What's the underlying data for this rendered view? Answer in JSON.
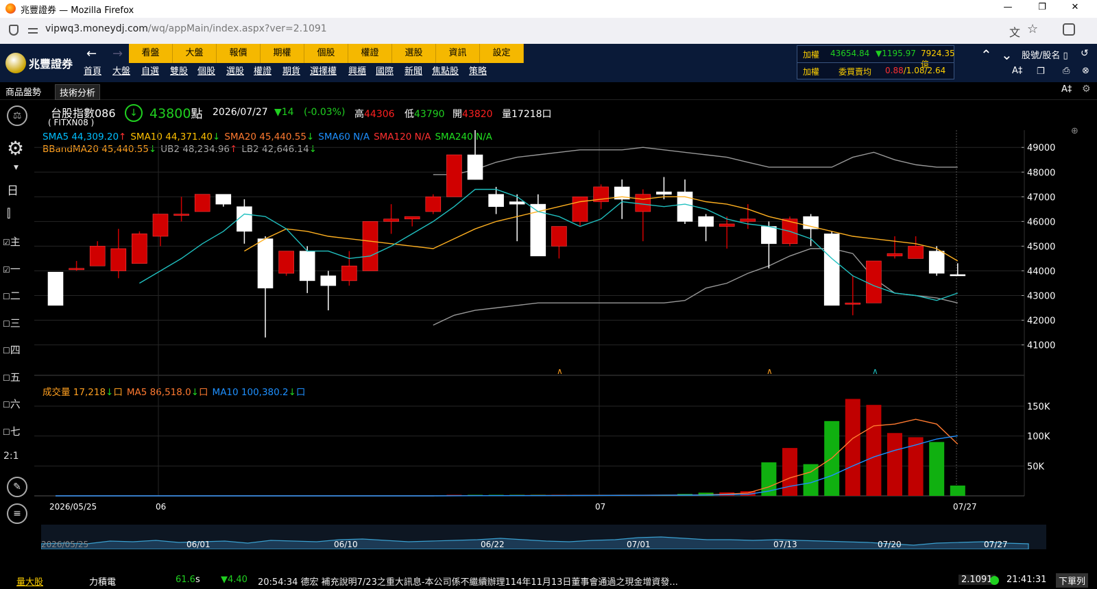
{
  "window": {
    "title": "兆豐證券 — Mozilla Firefox",
    "minimize": "—",
    "maximize": "❐",
    "close": "✕"
  },
  "urlbar": {
    "url_host": "vipwq3.moneydj.com",
    "url_path": "/wq/appMain/index.aspx?ver=2.1091"
  },
  "app": {
    "logo_text": "兆豐證券"
  },
  "menu_top": [
    "看盤",
    "大盤",
    "報價",
    "期權",
    "個股",
    "權證",
    "選股",
    "資訊",
    "設定"
  ],
  "menu_bottom": [
    "首頁",
    "大盤",
    "自選",
    "雙股",
    "個股",
    "選股",
    "權證",
    "期貨",
    "選擇權",
    "興櫃",
    "國際",
    "新聞",
    "焦點股",
    "策略"
  ],
  "index_panel": {
    "row1_label": "加權",
    "row1_value": "43654.84",
    "row1_change": "▼1195.97",
    "row1_amount": "7924.35億",
    "row2_label": "加權",
    "row2_sub": "委買賣均",
    "row2_v1": "0.88",
    "row2_sep1": "/",
    "row2_v2": "1.08",
    "row2_sep2": "/",
    "row2_v3": "2.64"
  },
  "right_tools": {
    "search_label": "股號/股名",
    "font_label": "A‡",
    "font2_label": "A‡"
  },
  "subtabs": [
    "商品盤勢",
    "技術分析"
  ],
  "left_items": [
    "主",
    "一",
    "二",
    "三",
    "四",
    "五",
    "六",
    "七"
  ],
  "left_ratio": "2:1",
  "header": {
    "name": "台股指數086",
    "code": "( FITXN08 )",
    "price": "43800",
    "price_unit": "點",
    "date": "2026/07/27",
    "change": "▼14",
    "change_pct": "(-0.03%)",
    "high_label": "高",
    "high": "44306",
    "low_label": "低",
    "low": "43790",
    "open_label": "開",
    "open": "43820",
    "vol_label": "量",
    "vol": "17218口"
  },
  "indicators_row1": [
    {
      "text": "SMA5 44,309.20",
      "arrow": "↑",
      "color": "#00bfff",
      "arrow_color": "#ff3030"
    },
    {
      "text": "SMA10 44,371.40",
      "arrow": "↓",
      "color": "#ffc000",
      "arrow_color": "#20d020"
    },
    {
      "text": "SMA20 45,440.55",
      "arrow": "↓",
      "color": "#ff7a30",
      "arrow_color": "#20d020"
    },
    {
      "text": "SMA60 N/A",
      "arrow": "",
      "color": "#1e90ff",
      "arrow_color": "#fff"
    },
    {
      "text": "SMA120 N/A",
      "arrow": "",
      "color": "#ff3030",
      "arrow_color": "#fff"
    },
    {
      "text": "SMA240 N/A",
      "arrow": "",
      "color": "#20e020",
      "arrow_color": "#fff"
    }
  ],
  "indicators_row2": [
    {
      "text": "BBandMA20 45,440.55",
      "arrow": "↓",
      "color": "#ffa020",
      "arrow_color": "#20d020"
    },
    {
      "text": "UB2 48,234.96",
      "arrow": "↑",
      "color": "#aaaaaa",
      "arrow_color": "#ff3030"
    },
    {
      "text": "LB2 42,646.14",
      "arrow": "↓",
      "color": "#aaaaaa",
      "arrow_color": "#20d020"
    }
  ],
  "volume_legend": [
    {
      "text": "成交量 17,218",
      "arrow": "↓",
      "box": "口",
      "color": "#ffa020"
    },
    {
      "text": "MA5 86,518.0",
      "arrow": "↓",
      "box": "口",
      "color": "#ff7a30"
    },
    {
      "text": "MA10 100,380.2",
      "arrow": "↓",
      "box": "口",
      "color": "#1e90ff"
    }
  ],
  "x_labels": [
    "2026/05/25",
    "06",
    "07",
    "07/27"
  ],
  "nav_labels": [
    "2026/05/25",
    "06/01",
    "06/10",
    "06/22",
    "07/01",
    "07/13",
    "07/20",
    "07/27"
  ],
  "ticker": {
    "tab": "量大股",
    "stock": "力積電",
    "price": "61.6",
    "price_suffix": "s",
    "change": "▼4.40",
    "news": "20:54:34 德宏 補充說明7/23之重大訊息-本公司係不繼續辦理114年11月13日董事會通過之現金增資發...",
    "version": "2.1091",
    "time": "21:41:31",
    "order_label": "下單列"
  },
  "colors": {
    "up": "#d00000",
    "down": "#ffffff",
    "vol_up": "#c00000",
    "vol_down": "#10b010",
    "sma5": "#20c0c0",
    "sma10": "#ffb020",
    "bband": "#999999",
    "accent": "#f5b800"
  },
  "chart_data": {
    "type": "candlestick",
    "ylim": [
      40600,
      49700
    ],
    "yticks": [
      41000,
      42000,
      43000,
      44000,
      45000,
      46000,
      47000,
      48000,
      49000
    ],
    "candles": [
      [
        43950,
        43950,
        42600,
        42600
      ],
      [
        44100,
        44400,
        44000,
        44100
      ],
      [
        44200,
        45200,
        44200,
        45000
      ],
      [
        44000,
        45700,
        43700,
        44900
      ],
      [
        44300,
        45600,
        44300,
        45500
      ],
      [
        45400,
        46300,
        45000,
        46300
      ],
      [
        46300,
        47000,
        46000,
        46300
      ],
      [
        46400,
        47100,
        46400,
        47100
      ],
      [
        47100,
        47100,
        46600,
        46700
      ],
      [
        46600,
        46900,
        45100,
        45600
      ],
      [
        45300,
        45400,
        41300,
        43300
      ],
      [
        43900,
        44800,
        43800,
        44800
      ],
      [
        44800,
        45000,
        43100,
        43600
      ],
      [
        43800,
        44000,
        42400,
        43400
      ],
      [
        43600,
        44800,
        43400,
        44200
      ],
      [
        44000,
        46000,
        44000,
        46000
      ],
      [
        46000,
        46700,
        45500,
        46100
      ],
      [
        46100,
        46200,
        45800,
        46200
      ],
      [
        46400,
        47100,
        46300,
        47000
      ],
      [
        47000,
        47900,
        47000,
        48700
      ],
      [
        48700,
        49700,
        47700,
        47700
      ],
      [
        47100,
        47400,
        46300,
        46600
      ],
      [
        46800,
        47100,
        45200,
        46700
      ],
      [
        46700,
        47100,
        44600,
        44600
      ],
      [
        45000,
        45700,
        44500,
        45800
      ],
      [
        46000,
        47000,
        45800,
        47000
      ],
      [
        46800,
        47500,
        46500,
        47400
      ],
      [
        47400,
        47700,
        46100,
        46900
      ],
      [
        46400,
        47300,
        45200,
        47100
      ],
      [
        47200,
        47800,
        46900,
        47100
      ],
      [
        47200,
        47700,
        45900,
        46000
      ],
      [
        46200,
        46300,
        45200,
        45800
      ],
      [
        45800,
        46200,
        44900,
        45900
      ],
      [
        46000,
        46700,
        45700,
        46100
      ],
      [
        45800,
        46000,
        44100,
        45100
      ],
      [
        45100,
        46200,
        45000,
        46100
      ],
      [
        46200,
        46300,
        45000,
        45700
      ],
      [
        45500,
        45600,
        42600,
        42600
      ],
      [
        42700,
        43800,
        42200,
        42700
      ],
      [
        42700,
        44400,
        42700,
        44400
      ],
      [
        44600,
        45400,
        44500,
        44700
      ],
      [
        44500,
        45400,
        44500,
        45000
      ],
      [
        44800,
        45000,
        43800,
        43900
      ],
      [
        43850,
        44306,
        43790,
        43800
      ]
    ],
    "sma5": [
      null,
      null,
      null,
      null,
      43500,
      44000,
      44500,
      45100,
      45600,
      46300,
      46200,
      45700,
      44800,
      44800,
      44500,
      44600,
      45000,
      45500,
      46000,
      46600,
      47300,
      47300,
      47000,
      46400,
      46200,
      45800,
      46100,
      46800,
      46700,
      46600,
      46700,
      46500,
      46100,
      45900,
      45800,
      45600,
      45300,
      44500,
      43800,
      43400,
      43100,
      43000,
      42800,
      43100
    ],
    "sma10": [
      null,
      null,
      null,
      null,
      null,
      null,
      null,
      null,
      null,
      44800,
      45300,
      45700,
      45600,
      45400,
      45300,
      45200,
      45100,
      45000,
      44900,
      45300,
      45700,
      46000,
      46200,
      46400,
      46600,
      46800,
      46900,
      47000,
      46900,
      47000,
      47000,
      46800,
      46700,
      46500,
      46200,
      46000,
      45800,
      45600,
      45400,
      45300,
      45200,
      45100,
      44900,
      44400
    ],
    "bb_ub": [
      null,
      null,
      null,
      null,
      null,
      null,
      null,
      null,
      null,
      null,
      null,
      null,
      null,
      null,
      null,
      null,
      null,
      null,
      47900,
      47900,
      48100,
      48400,
      48600,
      48700,
      48800,
      48900,
      48900,
      48900,
      49000,
      48900,
      48800,
      48700,
      48600,
      48400,
      48200,
      48200,
      48200,
      48200,
      48600,
      48800,
      48500,
      48300,
      48200,
      48200
    ],
    "bb_lb": [
      null,
      null,
      null,
      null,
      null,
      null,
      null,
      null,
      null,
      null,
      null,
      null,
      null,
      null,
      null,
      null,
      null,
      null,
      41800,
      42200,
      42400,
      42500,
      42600,
      42700,
      42700,
      42700,
      42700,
      42700,
      42700,
      42700,
      42800,
      43300,
      43500,
      43900,
      44200,
      44600,
      44900,
      44900,
      44700,
      43700,
      43100,
      43000,
      42900,
      42700
    ],
    "volume": [
      0,
      0,
      0,
      0,
      0,
      0,
      0,
      0,
      0,
      0,
      0,
      0,
      0,
      0,
      0,
      0,
      0,
      0,
      0,
      200,
      600,
      400,
      700,
      1200,
      800,
      1000,
      900,
      1300,
      1200,
      1500,
      3200,
      5300,
      5800,
      7800,
      56000,
      80000,
      53000,
      125000,
      162000,
      152000,
      105000,
      98000,
      90000,
      17218
    ],
    "vol_ma5": [
      0,
      0,
      0,
      0,
      0,
      0,
      0,
      0,
      0,
      0,
      0,
      0,
      0,
      0,
      0,
      0,
      0,
      0,
      0,
      200,
      300,
      400,
      500,
      600,
      700,
      800,
      900,
      1000,
      1000,
      1100,
      1400,
      1700,
      3000,
      4800,
      15000,
      30000,
      40000,
      63000,
      96000,
      117000,
      120000,
      128000,
      120000,
      86518
    ],
    "vol_ma10": [
      0,
      0,
      0,
      0,
      0,
      0,
      0,
      0,
      0,
      0,
      0,
      0,
      0,
      0,
      0,
      0,
      0,
      0,
      0,
      100,
      200,
      300,
      300,
      400,
      500,
      600,
      700,
      800,
      900,
      1000,
      1200,
      1400,
      2000,
      2500,
      8000,
      16000,
      22000,
      34000,
      50000,
      65000,
      76000,
      85000,
      95000,
      100380
    ],
    "vol_ylim": [
      0,
      190000
    ],
    "vol_ticks": [
      "50K",
      "100K",
      "150K"
    ],
    "vol_tick_values": [
      50000,
      100000,
      150000
    ],
    "nav_series": [
      0.3,
      0.35,
      0.3,
      0.5,
      0.45,
      0.55,
      0.4,
      0.45,
      0.5,
      0.35,
      0.55,
      0.5,
      0.45,
      0.6,
      0.65,
      0.55,
      0.45,
      0.5,
      0.55,
      0.6,
      0.7,
      0.6,
      0.5,
      0.45,
      0.55,
      0.6,
      0.75,
      0.8,
      0.7,
      0.6,
      0.6,
      0.55,
      0.6,
      0.55,
      0.5,
      0.45,
      0.4,
      0.3,
      0.2,
      0.35,
      0.4,
      0.45,
      0.35,
      0.3
    ]
  }
}
